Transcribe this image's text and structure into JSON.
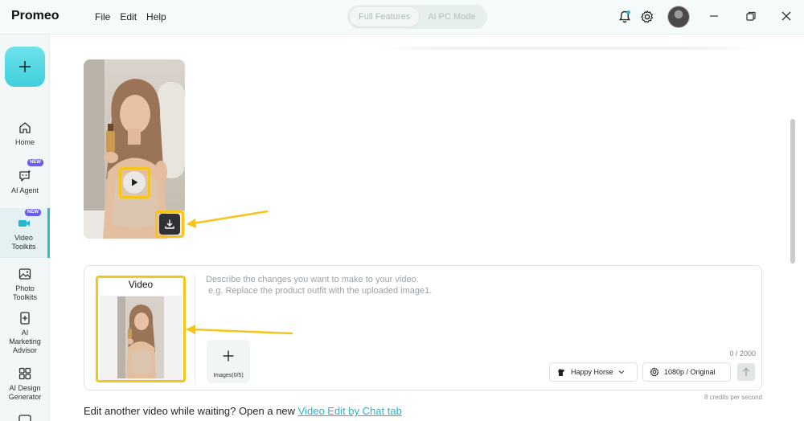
{
  "app": {
    "title": "Promeo"
  },
  "menu": {
    "file": "File",
    "edit": "Edit",
    "help": "Help"
  },
  "mode_toggle": {
    "full": "Full Features",
    "ai_pc": "AI PC Mode"
  },
  "sidebar": {
    "items": [
      {
        "label": "Home",
        "badge": ""
      },
      {
        "label": "AI Agent",
        "badge": "NEW"
      },
      {
        "label": "Video Toolkits",
        "badge": "NEW"
      },
      {
        "label": "Photo Toolkits",
        "badge": ""
      },
      {
        "label": "AI Marketing Advisor",
        "badge": ""
      },
      {
        "label": "AI Design Generator",
        "badge": ""
      }
    ]
  },
  "composer": {
    "video_label": "Video",
    "placeholder_line1": "Describe the changes you want to make to your video.",
    "placeholder_line2": " e.g. Replace the product outfit with the uploaded image1.",
    "images_label": "Images(0/5)",
    "char_count": "0 / 2000",
    "model": "Happy Horse",
    "resolution": "1080p / Original",
    "credits": "8 credits per second"
  },
  "footer": {
    "text": "Edit another video while waiting? Open a new ",
    "link": "Video Edit by Chat tab"
  },
  "colors": {
    "accent": "#2cbccc",
    "highlight": "#f5c518",
    "new_badge": "#6b5bf0"
  }
}
